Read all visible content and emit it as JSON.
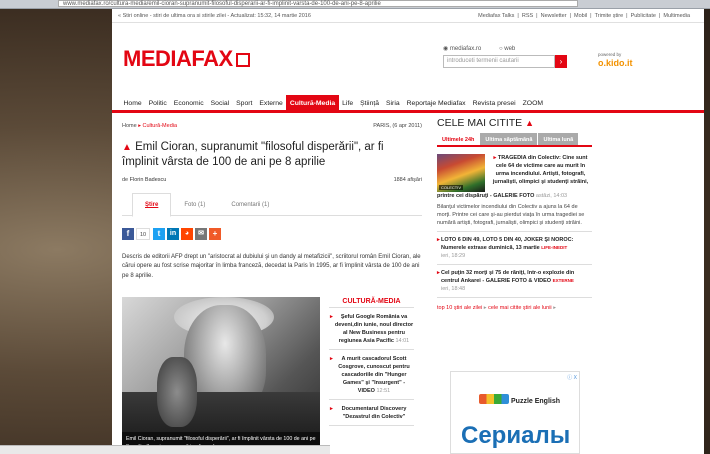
{
  "browser": {
    "url": "www.mediafax.ro/cultura-media/emil-cioran-supranumit-filosoful-disperarii-ar-fi-implinit-varsta-de-100-de-ani-pe-8-aprilie"
  },
  "topstrip": {
    "left": "« Stiri online - stiri de ultima ora si stirile zilei - Actualizat: 15:32, 14 martie 2016",
    "links": [
      "Mediafax Talks",
      "RSS",
      "Newsletter",
      "Mobil",
      "Trimite știre",
      "Publicitate",
      "Multimedia"
    ]
  },
  "header": {
    "logo": "MEDIAFAX",
    "search_options": [
      "mediafax.ro",
      "web"
    ],
    "search_placeholder": "introduceti termenii cautarii",
    "sponsor_label": "powered by",
    "sponsor_name": "o.kido.it"
  },
  "nav": [
    "Home",
    "Politic",
    "Economic",
    "Social",
    "Sport",
    "Externe",
    "Cultură-Media",
    "Life",
    "Știință",
    "Siria",
    "Reportaje Mediafax",
    "Revista presei",
    "ZOOM"
  ],
  "nav_active": "Cultură-Media",
  "article": {
    "breadcrumb_home": "Home",
    "breadcrumb_section": "Cultură-Media",
    "location_date": "PARIS, (6 apr 2011)",
    "title": "Emil Cioran, supranumit \"filosoful disperării\", ar fi împlinit vârsta de 100 de ani pe 8 aprilie",
    "author_prefix": "de",
    "author": "Florin Badescu",
    "views": "1884 afişări",
    "tabs": [
      "Ştire",
      "Foto (1)",
      "Comentarii (1)"
    ],
    "share_count": "10",
    "lead": "Descris de editorii AFP drept un \"aristocrat al dubiului şi un dandy al metafizicii\", scriitorul român Emil Cioran, ale cărui opere au fost scrise majoritar în limba franceză, decedat la Paris în 1995, ar fi împlinit vârsta de 100 de ani pe 8 aprilie.",
    "photo_caption": "Emil Cioran, supranumit \"filosoful disperării\", ar fi împlinit vârsta de 100 de ani pe 8 aprilie (Imagine: www.wikipedia.org)"
  },
  "cultura": {
    "heading": "CULTURĂ-MEDIA",
    "items": [
      {
        "text": "Şeful Google România va deveni,din iunie, noul director al New Business pentru regiunea Asia Pacific",
        "time": "14:01"
      },
      {
        "text": "A murit cascadorul Scott Cosgrove, cunoscut pentru cascadoriile din \"Hunger Games\" şi \"Insurgent\" - VIDEO",
        "time": "12:51"
      },
      {
        "text": "Documentarul Discovery \"Dezastrul din Colectiv\"",
        "time": ""
      }
    ]
  },
  "sidebar": {
    "heading": "CELE MAI CITITE",
    "tabs": [
      "Ultimele 24h",
      "Ultima săptămână",
      "Ultima lună"
    ],
    "featured_text": "TRAGEDIA din Colectiv: Cine sunt cele 64 de victime care au murit în urma incendiului. Artişti, fotografi, jurnalişti, olimpici şi studenţi străini,",
    "featured_cont": "printre cei dispăruţi - GALERIE FOTO",
    "featured_time": "astăzi, 14:03",
    "thumb_label": "COLECTIV",
    "featured_para": "Bilanţul victimelor incendiului din Colectiv a ajuns la 64 de morţi. Printre cei care şi-au pierdut viaţa în urma tragediei se numără artişti, fotografi, jurnalişti, olimpici şi studenţi străini.",
    "items": [
      {
        "text": "LOTO 6 DIN 49, LOTO 5 DIN 40, JOKER ŞI NOROC: Numerele extrase duminică, 13 martie",
        "tag": "LIFE-INEDIT",
        "time": "ieri, 18:29"
      },
      {
        "text": "Cel puţin 32 morţi şi 75 de răniţi, într-o explozie din centrul Ankarei - GALERIE FOTO & VIDEO",
        "tag": "EXTERNE",
        "time": "ieri, 18:48"
      }
    ],
    "top10_a": "top 10 ştiri ale zilei",
    "top10_b": "cele mai citite ştiri ale lunii"
  },
  "ad": {
    "marker": "ⓘ X",
    "title": "Puzzle English",
    "big_text": "Сериалы"
  },
  "colors": {
    "brand_red": "#e30613",
    "link_blue": "#1b6fb5"
  }
}
